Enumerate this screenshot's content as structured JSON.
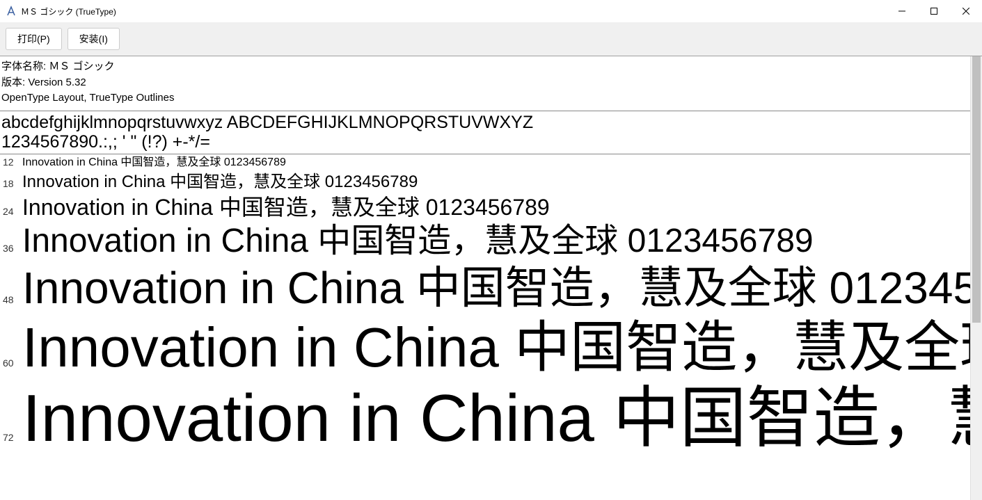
{
  "window": {
    "title": "ＭＳ ゴシック (TrueType)"
  },
  "toolbar": {
    "print_label": "打印(P)",
    "install_label": "安装(I)"
  },
  "meta": {
    "font_name_label": "字体名称:",
    "font_name_value": "ＭＳ ゴシック",
    "version_label": "版本:",
    "version_value": "Version 5.32",
    "tech_line": "OpenType Layout, TrueType Outlines"
  },
  "charset": {
    "alpha": "abcdefghijklmnopqrstuvwxyz ABCDEFGHIJKLMNOPQRSTUVWXYZ",
    "symbols": "1234567890.:,; ' \" (!?) +-*/="
  },
  "sample_text": "Innovation in China 中国智造，慧及全球 0123456789",
  "sample_sizes": [
    "12",
    "18",
    "24",
    "36",
    "48",
    "60",
    "72"
  ]
}
